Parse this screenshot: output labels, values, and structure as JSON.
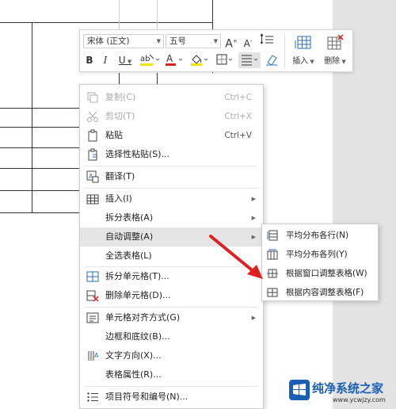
{
  "toolbar": {
    "font_name": "宋体 (正文)",
    "font_size": "五号",
    "grow_font": "A",
    "shrink_font": "A",
    "bold": "B",
    "italic": "I",
    "underline": "U",
    "insert_label": "插入",
    "delete_label": "删除"
  },
  "context_menu": {
    "items": [
      {
        "label": "复制(C)",
        "shortcut": "Ctrl+C",
        "disabled": true,
        "icon": "copy-icon"
      },
      {
        "label": "剪切(T)",
        "shortcut": "Ctrl+X",
        "disabled": true,
        "icon": "scissors-icon"
      },
      {
        "label": "粘贴",
        "shortcut": "Ctrl+V",
        "icon": "paste-icon"
      },
      {
        "label": "选择性粘贴(S)...",
        "icon": "paste-special-icon"
      },
      {
        "label": "翻译(T)",
        "icon": "translate-icon"
      },
      {
        "label": "插入(I)",
        "icon": "insert-table-icon",
        "submenu": true
      },
      {
        "label": "拆分表格(A)",
        "submenu": true
      },
      {
        "label": "自动调整(A)",
        "submenu": true,
        "highlighted": true
      },
      {
        "label": "全选表格(L)"
      },
      {
        "label": "拆分单元格(T)...",
        "icon": "split-cell-icon"
      },
      {
        "label": "删除单元格(D)...",
        "icon": "delete-cell-icon"
      },
      {
        "label": "单元格对齐方式(G)",
        "icon": "cell-align-icon",
        "submenu": true
      },
      {
        "label": "边框和底纹(B)..."
      },
      {
        "label": "文字方向(X)...",
        "icon": "text-direction-icon"
      },
      {
        "label": "表格属性(R)..."
      },
      {
        "label": "项目符号和编号(N)...",
        "icon": "bullets-icon"
      }
    ]
  },
  "submenu": {
    "items": [
      {
        "label": "平均分布各行(N)",
        "icon": "distribute-rows-icon"
      },
      {
        "label": "平均分布各列(Y)",
        "icon": "distribute-columns-icon"
      },
      {
        "label": "根据窗口调整表格(W)",
        "icon": "fit-window-icon"
      },
      {
        "label": "根据内容调整表格(F)",
        "icon": "fit-content-icon"
      }
    ]
  },
  "watermark": {
    "title": "纯净系统之家",
    "url": "www.ycwjzy.com"
  },
  "colors": {
    "highlight": "#e5e5e5",
    "arrow": "#e02020",
    "brand": "#1a5fb4"
  }
}
